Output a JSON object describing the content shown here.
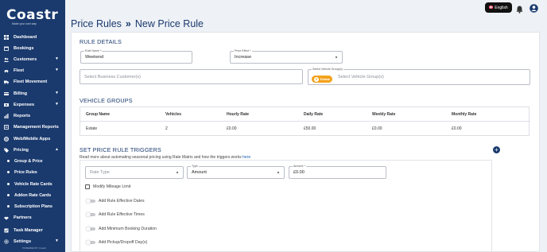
{
  "brand": {
    "name": "Coastr",
    "tagline": "Make your own way"
  },
  "sidebar": {
    "items": [
      {
        "label": "Dashboard",
        "icon": "dashboard-icon",
        "chevron": false
      },
      {
        "label": "Bookings",
        "icon": "calendar-icon",
        "chevron": false
      },
      {
        "label": "Customers",
        "icon": "customers-icon",
        "chevron": true
      },
      {
        "label": "Fleet",
        "icon": "car-icon",
        "chevron": true
      },
      {
        "label": "Fleet Movement",
        "icon": "truck-icon",
        "chevron": false
      },
      {
        "label": "Billing",
        "icon": "billing-icon",
        "chevron": true
      },
      {
        "label": "Expenses",
        "icon": "expenses-icon",
        "chevron": true
      },
      {
        "label": "Reports",
        "icon": "reports-icon",
        "chevron": false
      },
      {
        "label": "Management Reports",
        "icon": "management-reports-icon",
        "chevron": false
      },
      {
        "label": "Web/Mobile Apps",
        "icon": "globe-icon",
        "chevron": false
      },
      {
        "label": "Pricing",
        "icon": "tag-icon",
        "chevron": true
      }
    ],
    "pricing_sub": [
      {
        "label": "Group & Price"
      },
      {
        "label": "Price Rules"
      },
      {
        "label": "Vehicle Rate Cards"
      },
      {
        "label": "Addon Rate Cards"
      },
      {
        "label": "Subscription Plans"
      }
    ],
    "bottom_items": [
      {
        "label": "Partners",
        "icon": "partners-icon",
        "chevron": false
      },
      {
        "label": "Task Manager",
        "icon": "tasks-icon",
        "chevron": false
      },
      {
        "label": "Settings",
        "icon": "gear-icon",
        "chevron": true
      }
    ],
    "powered_by": "POWERED BY Coastr"
  },
  "topbar": {
    "language": "English"
  },
  "breadcrumb": {
    "parent": "Price Rules",
    "separator": "»",
    "current": "New Price Rule"
  },
  "rule_details": {
    "title": "RULE DETAILS",
    "rule_name": {
      "label": "Rule Name *",
      "value": "Weekend"
    },
    "price_effect": {
      "label": "Price Effect *",
      "value": "Increase"
    },
    "business_customers": {
      "placeholder": "Select Business Customer(s)"
    },
    "vehicle_groups": {
      "label": "Select Vehicle Group(s)",
      "chip": "Estate",
      "placeholder": "Select Vehicle Group(s)"
    }
  },
  "vehicle_groups": {
    "title": "VEHICLE GROUPS",
    "columns": [
      "Group Name",
      "Vehicles",
      "Hourly Rate",
      "Daily Rate",
      "Weekly Rate",
      "Monthly Rate"
    ],
    "rows": [
      [
        "Estate",
        "2",
        "£0.00",
        "£50.00",
        "£0.00",
        "£0.00"
      ]
    ]
  },
  "triggers": {
    "title": "SET PRICE RULE TRIGGERS",
    "description": "Read more about automating seasonal pricing using Rate Matrix and how the triggers works",
    "link": "here",
    "rate_type": {
      "placeholder": "Rate Type"
    },
    "type": {
      "label": "Type",
      "value": "Amount"
    },
    "amount": {
      "label": "Amount *",
      "value": "£0.00"
    },
    "checkbox_label": "Modify Mileage Limit",
    "toggles": [
      "Add Rule Effective Dates",
      "Add Rule Effective Times",
      "Add Minimum Booking Duration",
      "Add Pickup/Dropoff Day(s)"
    ]
  },
  "colors": {
    "sidebar": "#1a3a6e",
    "accent": "#f3a21c",
    "title": "#1a3a6e"
  }
}
